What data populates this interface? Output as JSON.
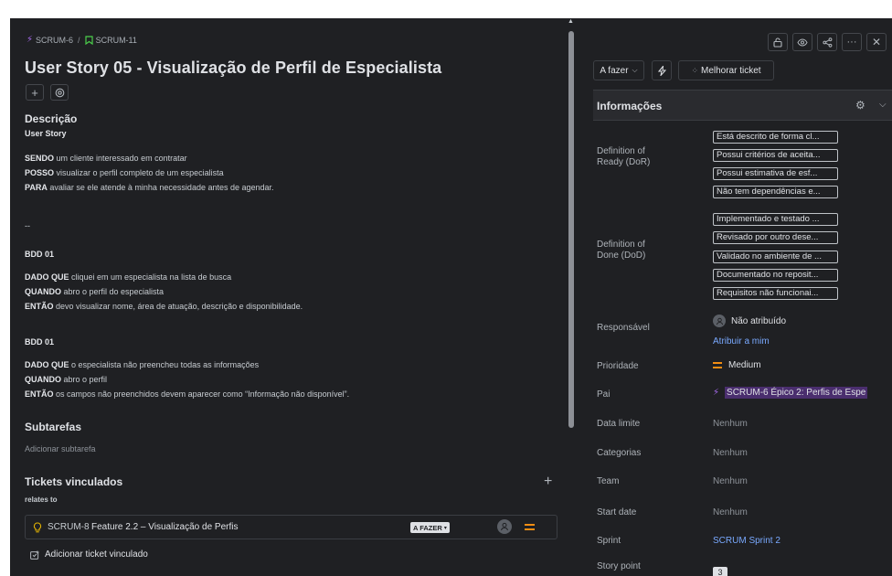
{
  "breadcrumb": {
    "parent": "SCRUM-6",
    "separator": "/",
    "current": "SCRUM-11"
  },
  "title": "User Story 05 - Visualização de Perfil de Especialista",
  "description": {
    "heading": "Descrição",
    "story_label": "User Story",
    "lines": [
      {
        "kw": "SENDO",
        "text": " um cliente interessado em contratar"
      },
      {
        "kw": "POSSO",
        "text": " visualizar o perfil completo de um especialista"
      },
      {
        "kw": "PARA",
        "text": " avaliar se ele atende à minha necessidade antes de agendar."
      }
    ],
    "divider": "--",
    "bdd1_title": "BDD 01",
    "bdd1_lines": [
      {
        "kw": "DADO QUE",
        "text": " cliquei em um especialista na lista de busca"
      },
      {
        "kw": "QUANDO",
        "text": " abro o perfil do especialista"
      },
      {
        "kw": "ENTÃO",
        "text": " devo visualizar nome, área de atuação, descrição e disponibilidade."
      }
    ],
    "bdd2_title": "BDD 01",
    "bdd2_lines": [
      {
        "kw": "DADO QUE",
        "text": " o especialista não preencheu todas as informações"
      },
      {
        "kw": "QUANDO",
        "text": " abro o perfil"
      },
      {
        "kw": "ENTÃO",
        "text": " os campos não preenchidos devem aparecer como “Informação não disponível”."
      }
    ]
  },
  "subtasks": {
    "heading": "Subtarefas",
    "add_label": "Adicionar subtarefa"
  },
  "linked": {
    "heading": "Tickets vinculados",
    "add_icon": "+",
    "relation": "relates to",
    "item": {
      "key": "SCRUM-8",
      "summary": "Feature 2.2 – Visualização de Perfis",
      "status": "A FAZER"
    },
    "add_label": "Adicionar ticket vinculado"
  },
  "right": {
    "status_button": "A fazer",
    "improve_button": "Melhorar ticket",
    "info_heading": "Informações",
    "dor_label": "Definition of Ready (DoR)",
    "dor_items": [
      "Está descrito de forma cl...",
      "Possui critérios de aceita...",
      "Possui estimativa de esf...",
      "Não tem dependências e..."
    ],
    "dod_label": "Definition of Done (DoD)",
    "dod_items": [
      "Implementado e testado ...",
      "Revisado por outro dese...",
      "Validado no ambiente de ...",
      "Documentado no reposit...",
      "Requisitos não funcionai..."
    ],
    "fields": {
      "responsavel_label": "Responsável",
      "responsavel_value": "Não atribuído",
      "assign_me": "Atribuir a mim",
      "prioridade_label": "Prioridade",
      "prioridade_value": "Medium",
      "pai_label": "Pai",
      "pai_value": "SCRUM-6 Épico 2: Perfis de Espe",
      "data_limite_label": "Data limite",
      "data_limite_value": "Nenhum",
      "categorias_label": "Categorias",
      "categorias_value": "Nenhum",
      "team_label": "Team",
      "team_value": "Nenhum",
      "start_label": "Start date",
      "start_value": "Nenhum",
      "sprint_label": "Sprint",
      "sprint_value": "SCRUM Sprint 2",
      "story_point_label": "Story point",
      "story_point_value": "3"
    }
  },
  "colors": {
    "background": "#1f2023",
    "link": "#79a9ff",
    "priority": "#f18d13",
    "epic": "#a86bf0"
  }
}
